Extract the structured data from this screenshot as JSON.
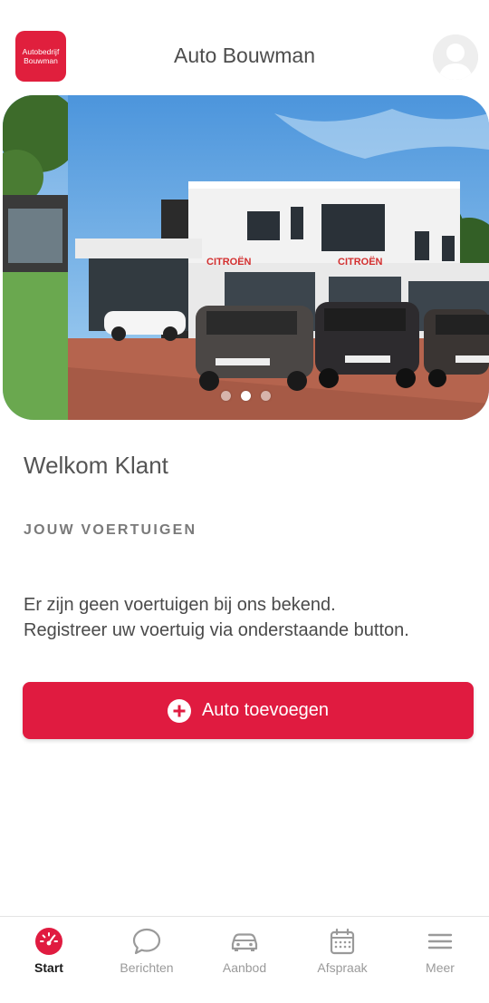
{
  "header": {
    "logo_line1": "Autobedrijf",
    "logo_line2": "Bouwman",
    "title": "Auto Bouwman"
  },
  "carousel": {
    "total_slides": 3,
    "active_index": 2
  },
  "main": {
    "welcome": "Welkom Klant",
    "section_label": "JOUW VOERTUIGEN",
    "info_line1": "Er zijn geen voertuigen bij ons bekend.",
    "info_line2": "Registreer uw voertuig via onderstaande button.",
    "add_button_label": "Auto toevoegen"
  },
  "tabs": [
    {
      "label": "Start",
      "icon": "speedometer-icon",
      "active": true
    },
    {
      "label": "Berichten",
      "icon": "chat-bubble-icon",
      "active": false
    },
    {
      "label": "Aanbod",
      "icon": "car-icon",
      "active": false
    },
    {
      "label": "Afspraak",
      "icon": "calendar-icon",
      "active": false
    },
    {
      "label": "Meer",
      "icon": "menu-icon",
      "active": false
    }
  ],
  "colors": {
    "brand_red": "#e01b40",
    "tab_active": "#1a1a1a",
    "tab_inactive": "#9a9a9a"
  }
}
